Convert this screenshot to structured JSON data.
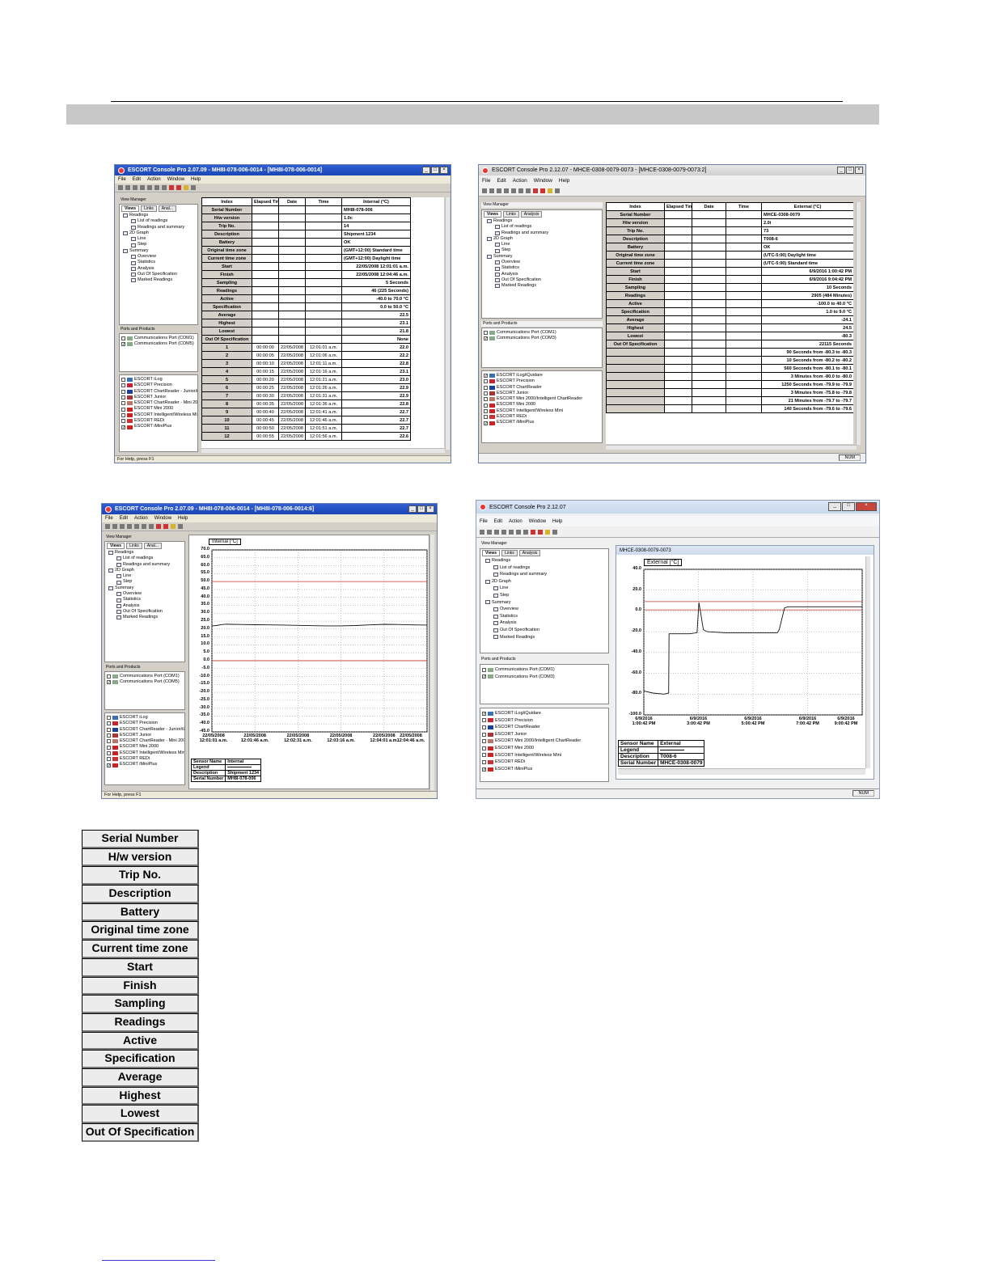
{
  "screens": {
    "win1": {
      "title": "ESCORT Console Pro 2.07.09 - MH8I-078-006-0014 - [MH8I-078-006-0014]",
      "menu": [
        "File",
        "Edit",
        "Action",
        "Window",
        "Help"
      ],
      "view_manager_title": "View Manager",
      "tabs": [
        "Views",
        "Links",
        "Anal..."
      ],
      "tree": [
        "Readings",
        "List of readings",
        "Readings and summary",
        "2D Graph",
        "Line",
        "Step",
        "Summary",
        "Overview",
        "Statistics",
        "Analysis",
        "Out Of Specification",
        "Marked Readings"
      ],
      "ports_title": "Ports and Products",
      "ports": [
        "Communications Port (COM1)",
        "Communications Port (COM5)"
      ],
      "products": [
        "ESCORT iLog",
        "ESCORT Precision",
        "ESCORT ChartReader - Junior/iLog",
        "ESCORT Junior",
        "ESCORT ChartReader - Mini 2000/I",
        "ESCORT Mini 2000",
        "ESCORT Intelligent/Wireless Mini",
        "ESCORT REDi",
        "ESCORT iMiniPlus"
      ],
      "headers": [
        "Index",
        "Elapsed Time",
        "Date",
        "Time",
        "Internal (°C)"
      ],
      "summary": [
        [
          "Serial Number",
          "MH8I-078-006"
        ],
        [
          "H/w version",
          "1.0c"
        ],
        [
          "Trip No.",
          "14"
        ],
        [
          "Description",
          "Shipment 1234"
        ],
        [
          "Battery",
          "OK"
        ],
        [
          "Original time zone",
          "(GMT+12:00) Standard time"
        ],
        [
          "Current time zone",
          "(GMT+12:00) Daylight time"
        ],
        [
          "Start",
          "22/05/2008 12:01:01 a.m."
        ],
        [
          "Finish",
          "22/05/2008 12:04:46 a.m."
        ],
        [
          "Sampling",
          "5 Seconds"
        ],
        [
          "Readings",
          "46 (225 Seconds)"
        ],
        [
          "Active",
          "-40.0 to 70.0 °C"
        ],
        [
          "Specification",
          "0.0 to 50.0 °C"
        ],
        [
          "Average",
          "22.5"
        ],
        [
          "Highest",
          "23.1"
        ],
        [
          "Lowest",
          "21.8"
        ],
        [
          "Out Of Specification",
          "None"
        ]
      ],
      "rows": [
        [
          "1",
          "00:00:00",
          "22/05/2008",
          "12:01:01 a.m.",
          "22.0"
        ],
        [
          "2",
          "00:00:05",
          "22/05/2008",
          "12:01:06 a.m.",
          "22.2"
        ],
        [
          "3",
          "00:00:10",
          "22/05/2008",
          "12:01:11 a.m.",
          "22.8"
        ],
        [
          "4",
          "00:00:15",
          "22/05/2008",
          "12:01:16 a.m.",
          "23.1"
        ],
        [
          "5",
          "00:00:20",
          "22/05/2008",
          "12:01:21 a.m.",
          "23.0"
        ],
        [
          "6",
          "00:00:25",
          "22/05/2008",
          "12:01:26 a.m.",
          "22.9"
        ],
        [
          "7",
          "00:00:30",
          "22/05/2008",
          "12:01:31 a.m.",
          "22.9"
        ],
        [
          "8",
          "00:00:35",
          "22/05/2008",
          "12:01:36 a.m.",
          "22.8"
        ],
        [
          "9",
          "00:00:40",
          "22/05/2008",
          "12:01:41 a.m.",
          "22.7"
        ],
        [
          "10",
          "00:00:45",
          "22/05/2008",
          "12:01:46 a.m.",
          "22.7"
        ],
        [
          "11",
          "00:00:50",
          "22/05/2008",
          "12:01:51 a.m.",
          "22.7"
        ],
        [
          "12",
          "00:00:55",
          "22/05/2008",
          "12:01:56 a.m.",
          "22.6"
        ]
      ],
      "status": "For Help, press F1"
    },
    "win2": {
      "title": "ESCORT Console Pro 2.12.07 - MHCE-0308-0079-0073 - [MHCE-0308-0079-0073:2]",
      "menu": [
        "File",
        "Edit",
        "Action",
        "Window",
        "Help"
      ],
      "view_manager_title": "View Manager",
      "tabs": [
        "Views",
        "Links",
        "Analysis"
      ],
      "tree": [
        "Readings",
        "List of readings",
        "Readings and summary",
        "2D Graph",
        "Line",
        "Step",
        "Summary",
        "Overview",
        "Statistics",
        "Analysis",
        "Out Of Specification",
        "Marked Readings"
      ],
      "ports_title": "Ports and Products",
      "ports": [
        "Communications Port (COM1)",
        "Communications Port (COM3)"
      ],
      "products": [
        "ESCORT iLog/iQuidare",
        "ESCORT Precision",
        "ESCORT ChartReader",
        "ESCORT Junior",
        "ESCORT Mini 2000/Intelligent ChartReader",
        "ESCORT Mini 2000",
        "ESCORT Intelligent/Wireless Mini",
        "ESCORT REDi",
        "ESCORT iMiniPlus"
      ],
      "headers": [
        "Index",
        "Elapsed Time",
        "Date",
        "Time",
        "External (°C)"
      ],
      "summary": [
        [
          "Serial Number",
          "MHCE-0308-0079"
        ],
        [
          "H/w version",
          "2.0i"
        ],
        [
          "Trip No.",
          "73"
        ],
        [
          "Description",
          "T008-6"
        ],
        [
          "Battery",
          "OK"
        ],
        [
          "Original time zone",
          "(UTC-5:00) Daylight time"
        ],
        [
          "Current time zone",
          "(UTC-5:00) Standard time"
        ],
        [
          "Start",
          "6/9/2016 1:00:42 PM"
        ],
        [
          "Finish",
          "6/9/2016 9:04:42 PM"
        ],
        [
          "Sampling",
          "10 Seconds"
        ],
        [
          "Readings",
          "2905 (484 Minutes)"
        ],
        [
          "Active",
          "-100.0 to 40.0 °C"
        ],
        [
          "Specification",
          "1.0 to 9.0 °C"
        ],
        [
          "Average",
          "-24.1"
        ],
        [
          "Highest",
          "24.5"
        ],
        [
          "Lowest",
          "-80.3"
        ],
        [
          "Out Of Specification",
          "22115 Seconds"
        ]
      ],
      "oos_rows": [
        "90 Seconds from -80.3 to -80.3",
        "10 Seconds from -80.2 to -80.2",
        "560 Seconds from -80.1 to -80.1",
        "3 Minutes from -80.0 to -80.0",
        "1250 Seconds from -79.9 to -79.9",
        "3 Minutes from -75.8 to -79.8",
        "21 Minutes from -79.7 to -79.7",
        "140 Seconds from -79.6 to -79.6"
      ],
      "status_num": "NUM"
    },
    "win3": {
      "title": "ESCORT Console Pro 2.07.09 - MH8I-078-006-0014 - [MH8I-078-006-0014:6]",
      "menu": [
        "File",
        "Edit",
        "Action",
        "Window",
        "Help"
      ],
      "view_manager_title": "View Manager",
      "tabs": [
        "Views",
        "Links",
        "Anal..."
      ],
      "tree": [
        "Readings",
        "List of readings",
        "Readings and summary",
        "2D Graph",
        "Line",
        "Step",
        "Summary",
        "Overview",
        "Statistics",
        "Analysis",
        "Out Of Specification",
        "Marked Readings"
      ],
      "ports_title": "Ports and Products",
      "ports": [
        "Communications Port (COM1)",
        "Communications Port (COM5)"
      ],
      "products": [
        "ESCORT iLog",
        "ESCORT Precision",
        "ESCORT ChartReader - Junior/iLog",
        "ESCORT Junior",
        "ESCORT ChartReader - Mini 2000/I",
        "ESCORT Mini 2000",
        "ESCORT Intelligent/Wireless Mini",
        "ESCORT REDi",
        "ESCORT iMiniPlus"
      ],
      "legend": [
        [
          "Sensor Name",
          "Internal"
        ],
        [
          "Legend",
          ""
        ],
        [
          "Description",
          "Shipment 1234"
        ],
        [
          "Serial Number",
          "MH8I-078-006"
        ]
      ],
      "status": "For Help, press F1"
    },
    "win4": {
      "title": "ESCORT Console Pro 2.12.07",
      "menu": [
        "File",
        "Edit",
        "Action",
        "Window",
        "Help"
      ],
      "inner_title": "MHCE-0308-0079-0073",
      "view_manager_title": "View Manager",
      "tabs": [
        "Views",
        "Links",
        "Analysis"
      ],
      "tree": [
        "Readings",
        "List of readings",
        "Readings and summary",
        "2D Graph",
        "Line",
        "Step",
        "Summary",
        "Overview",
        "Statistics",
        "Analysis",
        "Out Of Specification",
        "Marked Readings"
      ],
      "ports_title": "Ports and Products",
      "ports": [
        "Communications Port (COM1)",
        "Communications Port (COM3)"
      ],
      "products": [
        "ESCORT iLog/iQuidare",
        "ESCORT Precision",
        "ESCORT ChartReader",
        "ESCORT Junior",
        "ESCORT Mini 2000/Intelligent ChartReader",
        "ESCORT Mini 2000",
        "ESCORT Intelligent/Wireless Mini",
        "ESCORT REDi",
        "ESCORT iMiniPlus"
      ],
      "legend": [
        [
          "Sensor Name",
          "External"
        ],
        [
          "Legend",
          ""
        ],
        [
          "Description",
          "T008-6"
        ],
        [
          "Serial Number",
          "MHCE-0308-0079"
        ]
      ],
      "status_num": "NUM"
    }
  },
  "chart_data": [
    {
      "type": "line",
      "title": "Internal [°C]",
      "ylim": [
        -45,
        70
      ],
      "yticks": [
        70.0,
        65.0,
        60.0,
        55.0,
        50.0,
        45.0,
        40.0,
        35.0,
        30.0,
        25.0,
        20.0,
        15.0,
        10.0,
        5.0,
        0.0,
        -5.0,
        -10.0,
        -15.0,
        -20.0,
        -25.0,
        -30.0,
        -35.0,
        -40.0,
        -45.0
      ],
      "xticks": [
        "22/05/2008\n12:01:01 a.m.",
        "22/05/2008\n12:01:46 a.m.",
        "22/05/2008\n12:02:31 a.m.",
        "22/05/2008\n12:03:16 a.m.",
        "22/05/2008\n12:04:01 a.m.",
        "22/05/2008\n12:04:46 a.m."
      ],
      "spec_limits": [
        0.0,
        50.0
      ],
      "x": [
        0,
        5,
        10,
        15,
        20,
        30,
        45,
        60,
        75,
        90,
        105,
        120,
        135,
        150,
        165,
        180,
        195,
        210,
        225
      ],
      "y": [
        22.0,
        22.2,
        22.8,
        23.1,
        23.0,
        22.9,
        22.7,
        22.6,
        22.5,
        22.3,
        22.1,
        22.0,
        22.0,
        22.2,
        22.6,
        23.0,
        22.9,
        22.6,
        22.5
      ],
      "grid": true
    },
    {
      "type": "line",
      "title": "External [°C]",
      "ylim": [
        -100,
        40
      ],
      "yticks": [
        40.0,
        20.0,
        0.0,
        -20.0,
        -40.0,
        -60.0,
        -80.0,
        -100.0
      ],
      "xticks": [
        "6/9/2016\n1:00:42 PM",
        "6/9/2016\n3:00:42 PM",
        "6/9/2016\n5:00:42 PM",
        "6/9/2016\n7:00:42 PM",
        "6/9/2016\n9:00:42 PM"
      ],
      "spec_limits": [
        1.0,
        9.0
      ],
      "x": [
        0,
        20,
        45,
        55,
        56,
        100,
        101,
        118,
        122,
        126,
        132,
        140,
        180,
        240,
        296,
        300,
        312,
        320,
        360,
        484
      ],
      "y": [
        -77,
        -79,
        -80,
        -79,
        -22,
        -22,
        -22,
        -21,
        8,
        -2,
        -18,
        -20,
        -21,
        -21,
        -21,
        -18,
        3,
        4,
        4,
        4
      ],
      "grid": true
    }
  ],
  "label_list": [
    "Serial Number",
    "H/w version",
    "Trip No.",
    "Description",
    "Battery",
    "Original time zone",
    "Current time zone",
    "Start",
    "Finish",
    "Sampling",
    "Readings",
    "Active",
    "Specification",
    "Average",
    "Highest",
    "Lowest",
    "Out Of Specification"
  ]
}
